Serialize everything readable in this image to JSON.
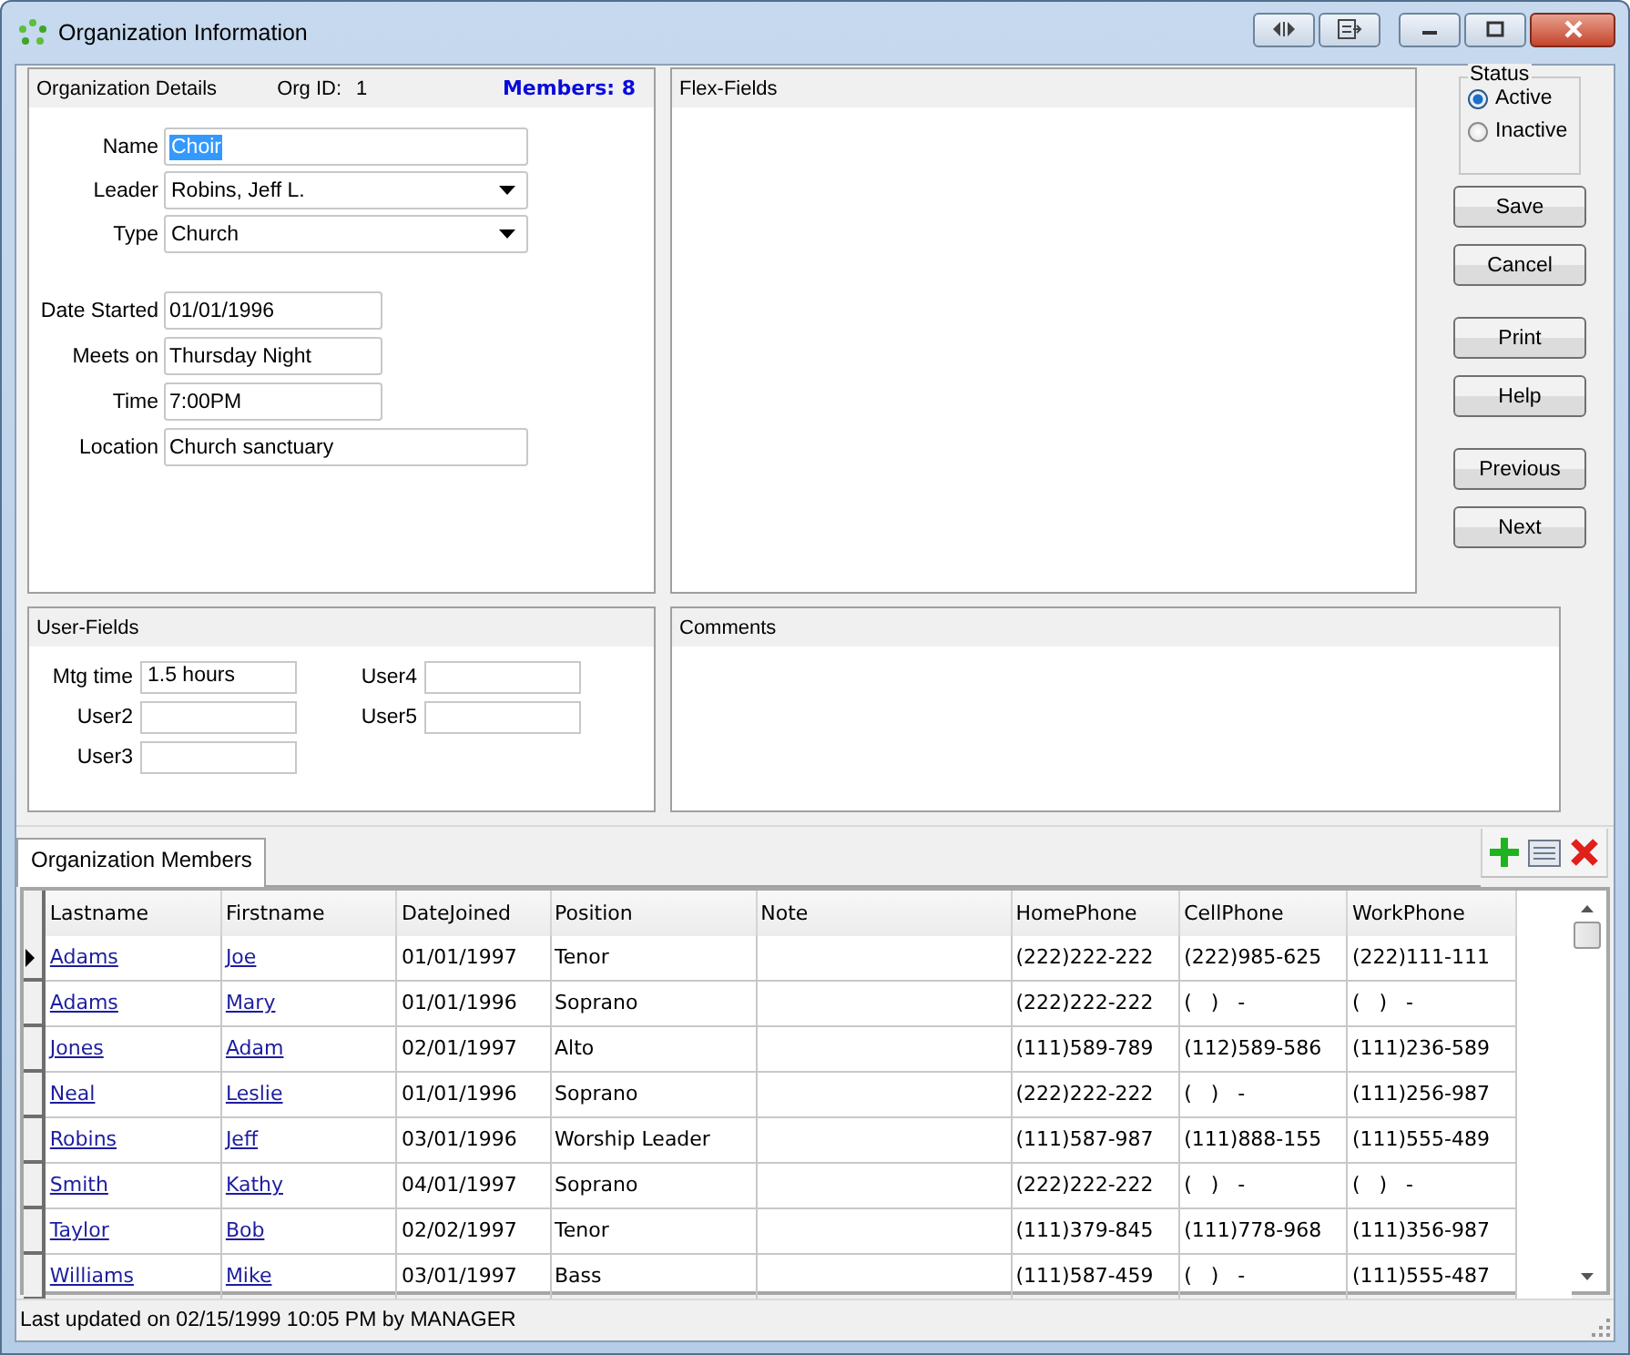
{
  "window": {
    "title": "Organization Information"
  },
  "details": {
    "title": "Organization Details",
    "org_id_label": "Org ID:",
    "org_id": "1",
    "members": "Members: 8",
    "fields": [
      {
        "kind": "text",
        "label": "Name",
        "value": "Choir",
        "selected": true
      },
      {
        "kind": "dropdown",
        "label": "Leader",
        "value": "Robins, Jeff L.",
        "selected": false
      },
      {
        "kind": "dropdown",
        "label": "Type",
        "value": "Church",
        "selected": false
      }
    ],
    "schedule": [
      {
        "label": "Date Started",
        "value": "01/01/1996"
      },
      {
        "label": "Meets on",
        "value": "Thursday Night"
      },
      {
        "label": "Time",
        "value": "7:00PM"
      },
      {
        "label": "Location",
        "value": "Church sanctuary"
      }
    ]
  },
  "flex_fields": {
    "title": "Flex-Fields"
  },
  "status": {
    "title": "Status",
    "options": [
      {
        "label": "Active",
        "selected": true
      },
      {
        "label": "Inactive",
        "selected": false
      }
    ]
  },
  "buttons": [
    "Save",
    "Cancel",
    "Print",
    "Help",
    "Previous",
    "Next"
  ],
  "user_fields": {
    "title": "User-Fields",
    "left": [
      {
        "label": "Mtg time",
        "value": "1.5 hours"
      },
      {
        "label": "User2"
      },
      {
        "label": "User3"
      }
    ],
    "right": [
      {
        "label": "User4"
      },
      {
        "label": "User5"
      }
    ]
  },
  "comments": {
    "title": "Comments"
  },
  "tabs": [
    {
      "label": "Organization Members",
      "selected": true
    }
  ],
  "grid": {
    "columns": [
      {
        "label": "Lastname",
        "kind": "link"
      },
      {
        "label": "Firstname",
        "kind": "link"
      },
      {
        "label": "DateJoined",
        "kind": "text"
      },
      {
        "label": "Position",
        "kind": "text"
      },
      {
        "label": "Note"
      },
      {
        "label": "HomePhone",
        "kind": "text"
      },
      {
        "label": "CellPhone",
        "kind": "text"
      },
      {
        "label": "WorkPhone",
        "kind": "text"
      }
    ],
    "rows": [
      {
        "current": true,
        "cells": [
          "Adams",
          "Joe",
          "01/01/1997",
          "Tenor",
          "",
          "(222)222-222",
          "(222)985-625",
          "(222)111-111"
        ]
      },
      {
        "current": false,
        "cells": [
          "Adams",
          "Mary",
          "01/01/1996",
          "Soprano",
          "",
          "(222)222-222",
          "(   )   -",
          "(   )   -"
        ]
      },
      {
        "current": false,
        "cells": [
          "Jones",
          "Adam",
          "02/01/1997",
          "Alto",
          "",
          "(111)589-789",
          "(112)589-586",
          "(111)236-589"
        ]
      },
      {
        "current": false,
        "cells": [
          "Neal",
          "Leslie",
          "01/01/1996",
          "Soprano",
          "",
          "(222)222-222",
          "(   )   -",
          "(111)256-987"
        ]
      },
      {
        "current": false,
        "cells": [
          "Robins",
          "Jeff",
          "03/01/1996",
          "Worship Leader",
          "",
          "(111)587-987",
          "(111)888-155",
          "(111)555-489"
        ]
      },
      {
        "current": false,
        "cells": [
          "Smith",
          "Kathy",
          "04/01/1997",
          "Soprano",
          "",
          "(222)222-222",
          "(   )   -",
          "(   )   -"
        ]
      },
      {
        "current": false,
        "cells": [
          "Taylor",
          "Bob",
          "02/02/1997",
          "Tenor",
          "",
          "(111)379-845",
          "(111)778-968",
          "(111)356-987"
        ]
      },
      {
        "current": false,
        "cells": [
          "Williams",
          "Mike",
          "03/01/1997",
          "Bass",
          "",
          "(111)587-459",
          "(   )   -",
          "(111)555-487"
        ]
      }
    ]
  },
  "status_bar": "Last updated on 02/15/1999 10:05 PM by MANAGER"
}
